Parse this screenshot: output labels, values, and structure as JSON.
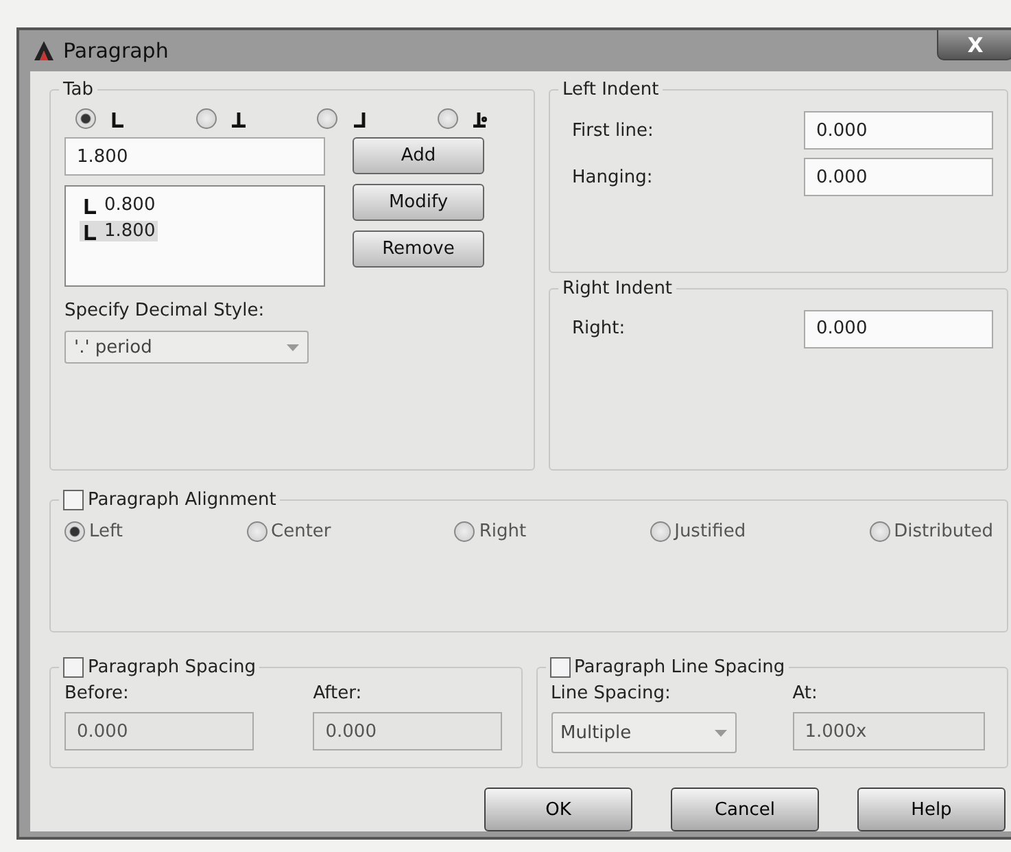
{
  "window": {
    "title": "Paragraph",
    "close": "X"
  },
  "tab": {
    "legend": "Tab",
    "types": [
      {
        "kind": "left",
        "selected": true
      },
      {
        "kind": "center",
        "selected": false
      },
      {
        "kind": "right",
        "selected": false
      },
      {
        "kind": "decimal",
        "selected": false
      }
    ],
    "value": "1.800",
    "stops": [
      {
        "kind": "left",
        "value": "0.800",
        "selected": false
      },
      {
        "kind": "left",
        "value": "1.800",
        "selected": true
      }
    ],
    "buttons": [
      "Add",
      "Modify",
      "Remove"
    ],
    "decimal_label": "Specify Decimal Style:",
    "decimal_value": "'.' period"
  },
  "left_indent": {
    "legend": "Left Indent",
    "fields": [
      {
        "label": "First line:",
        "value": "0.000"
      },
      {
        "label": "Hanging:",
        "value": "0.000"
      }
    ]
  },
  "right_indent": {
    "legend": "Right Indent",
    "fields": [
      {
        "label": "Right:",
        "value": "0.000"
      }
    ]
  },
  "alignment": {
    "legend": "Paragraph Alignment",
    "checked": false,
    "options": [
      {
        "label": "Left",
        "selected": true
      },
      {
        "label": "Center",
        "selected": false
      },
      {
        "label": "Right",
        "selected": false
      },
      {
        "label": "Justified",
        "selected": false
      },
      {
        "label": "Distributed",
        "selected": false
      }
    ]
  },
  "spacing": {
    "legend": "Paragraph Spacing",
    "checked": false,
    "fields": [
      {
        "label": "Before:",
        "value": "0.000"
      },
      {
        "label": "After:",
        "value": "0.000"
      }
    ]
  },
  "line_spacing": {
    "legend": "Paragraph Line Spacing",
    "checked": false,
    "type_label": "Line Spacing:",
    "type_value": "Multiple",
    "at_label": "At:",
    "at_value": "1.000x"
  },
  "buttons": [
    "OK",
    "Cancel",
    "Help"
  ]
}
